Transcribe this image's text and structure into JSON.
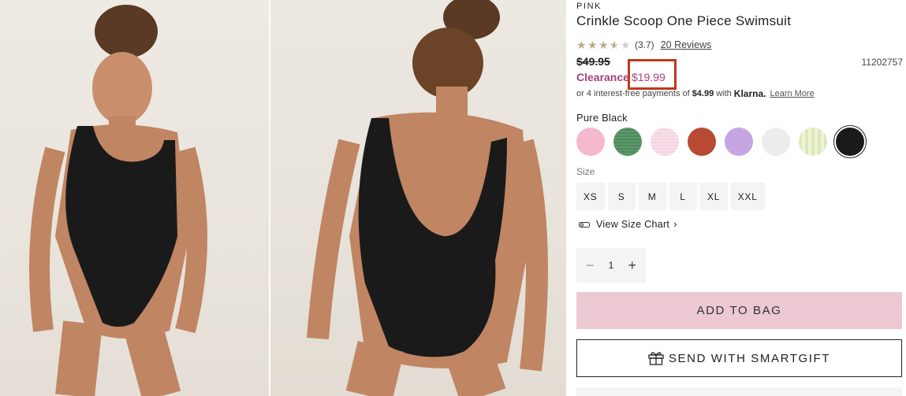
{
  "product": {
    "brand": "PINK",
    "title": "Crinkle Scoop One Piece Swimsuit",
    "rating_value": "(3.7)",
    "rating_stars": 3.5,
    "reviews_link": "20 Reviews",
    "original_price": "$49.95",
    "sku": "11202757",
    "clearance_label": "Clearance",
    "sale_price": "$19.99",
    "klarna": {
      "prefix": "or 4 interest-free payments of",
      "amount": "$4.99",
      "with": "with",
      "logo": "Klarna.",
      "learn_more": "Learn More"
    }
  },
  "color": {
    "selected_name": "Pure Black",
    "swatches": [
      {
        "name": "pink",
        "color": "#f4b9cf"
      },
      {
        "name": "green",
        "color": "#4f8a5e"
      },
      {
        "name": "light-pink",
        "color": "#f3d3e0"
      },
      {
        "name": "rust",
        "color": "#b84a33"
      },
      {
        "name": "lavender",
        "color": "#c5a6e2"
      },
      {
        "name": "white",
        "color": "#ececec"
      },
      {
        "name": "lime-gingham",
        "color": "#dde8b9"
      },
      {
        "name": "pure-black",
        "color": "#1a1a1a"
      }
    ]
  },
  "size": {
    "label": "Size",
    "options": [
      "XS",
      "S",
      "M",
      "L",
      "XL",
      "XXL"
    ],
    "chart_link": "View Size Chart"
  },
  "quantity": {
    "value": "1",
    "minus_icon": "minus-icon",
    "plus_icon": "plus-icon"
  },
  "actions": {
    "add_to_bag": "ADD TO BAG",
    "smartgift": "SEND WITH SMARTGIFT"
  },
  "images": [
    {
      "name": "model-front-photo"
    },
    {
      "name": "model-back-photo"
    }
  ]
}
